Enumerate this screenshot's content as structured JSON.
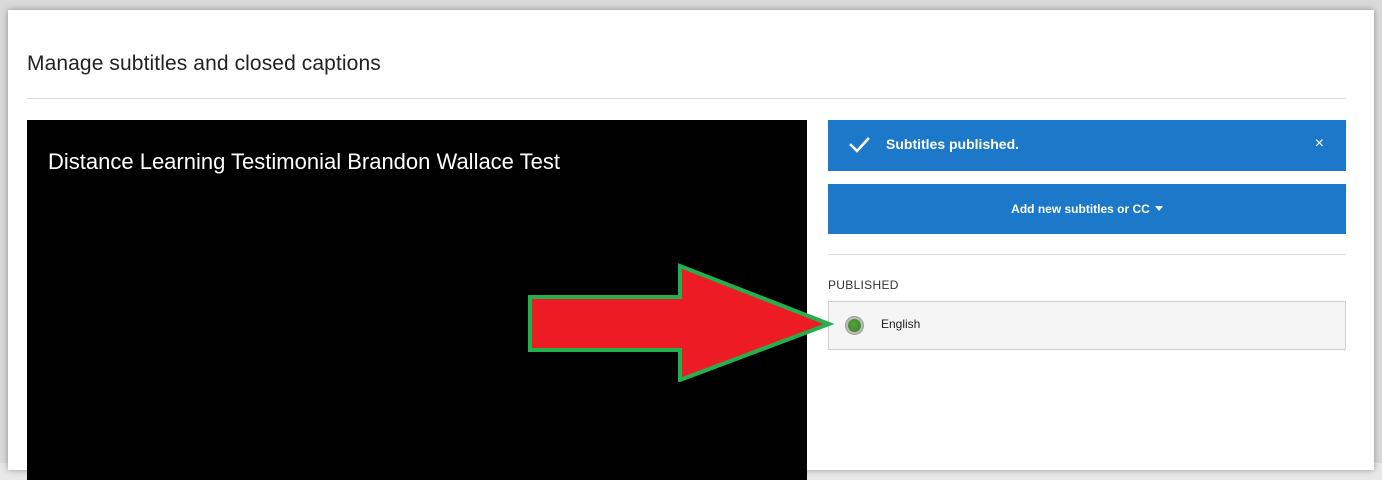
{
  "page": {
    "title": "Manage subtitles and closed captions"
  },
  "video": {
    "title": "Distance Learning Testimonial Brandon Wallace Test"
  },
  "notice": {
    "icon": "checkmark-icon",
    "text": "Subtitles published.",
    "close_label": "×",
    "color": "#1c78c9"
  },
  "add_button": {
    "label": "Add new subtitles or CC",
    "icon": "caret-down-icon",
    "color": "#1c78c9"
  },
  "published": {
    "section_label": "PUBLISHED",
    "items": [
      {
        "label": "English",
        "status_color": "#4a9a33"
      }
    ]
  },
  "annotation": {
    "icon": "arrow-right-icon",
    "fill_color": "#ed1c24",
    "outline_color": "#22b14c"
  }
}
